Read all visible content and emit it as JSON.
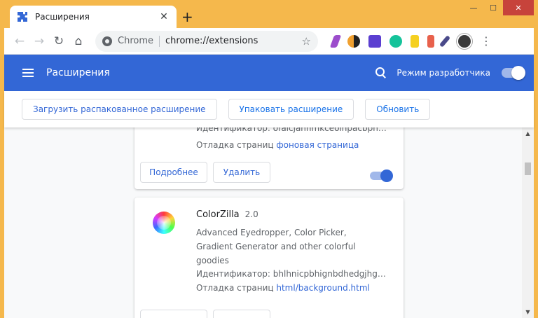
{
  "window": {
    "tab_title": "Расширения",
    "tab_close": "✕",
    "new_tab": "+",
    "controls": {
      "minimize": "—",
      "maximize": "☐",
      "close": "✕"
    }
  },
  "toolbar": {
    "back": "←",
    "forward": "→",
    "reload": "↻",
    "home": "⌂",
    "omnibox_origin": "Chrome",
    "omnibox_url": "chrome://extensions",
    "star": "☆",
    "menu": "⋮",
    "extension_icons": [
      {
        "name": "feather-icon",
        "color": "#9c4dcc"
      },
      {
        "name": "half-circle-icon",
        "color": "#f0a030"
      },
      {
        "name": "purple-square-icon",
        "color": "#5b3fd1"
      },
      {
        "name": "grammarly-icon",
        "color": "#15c39a"
      },
      {
        "name": "notes-badge-icon",
        "color": "#f5d020"
      },
      {
        "name": "lighthouse-icon",
        "color": "#e8614c"
      },
      {
        "name": "eyedropper-icon",
        "color": "#4a4a8a"
      }
    ]
  },
  "header": {
    "title": "Расширения",
    "dev_mode_label": "Режим разработчика",
    "dev_mode_on": true
  },
  "dev_toolbar": {
    "load_unpacked": "Загрузить распакованное расширение",
    "pack": "Упаковать расширение",
    "update": "Обновить"
  },
  "cards": [
    {
      "id_line": "Идентификатор: ofaicjahnmkceoihpacbpnk...",
      "inspect_label": "Отладка страниц",
      "inspect_link": "фоновая страница",
      "details_btn": "Подробнее",
      "remove_btn": "Удалить",
      "enabled": true
    },
    {
      "name": "ColorZilla",
      "version": "2.0",
      "description": "Advanced Eyedropper, Color Picker, Gradient Generator and other colorful goodies",
      "id_line": "Идентификатор: bhlhnicpbhignbdhedgjhgdocn...",
      "inspect_label": "Отладка страниц",
      "inspect_link": "html/background.html"
    }
  ],
  "colors": {
    "frame": "#f5b84c",
    "header": "#3367d6",
    "link": "#3367d6"
  }
}
